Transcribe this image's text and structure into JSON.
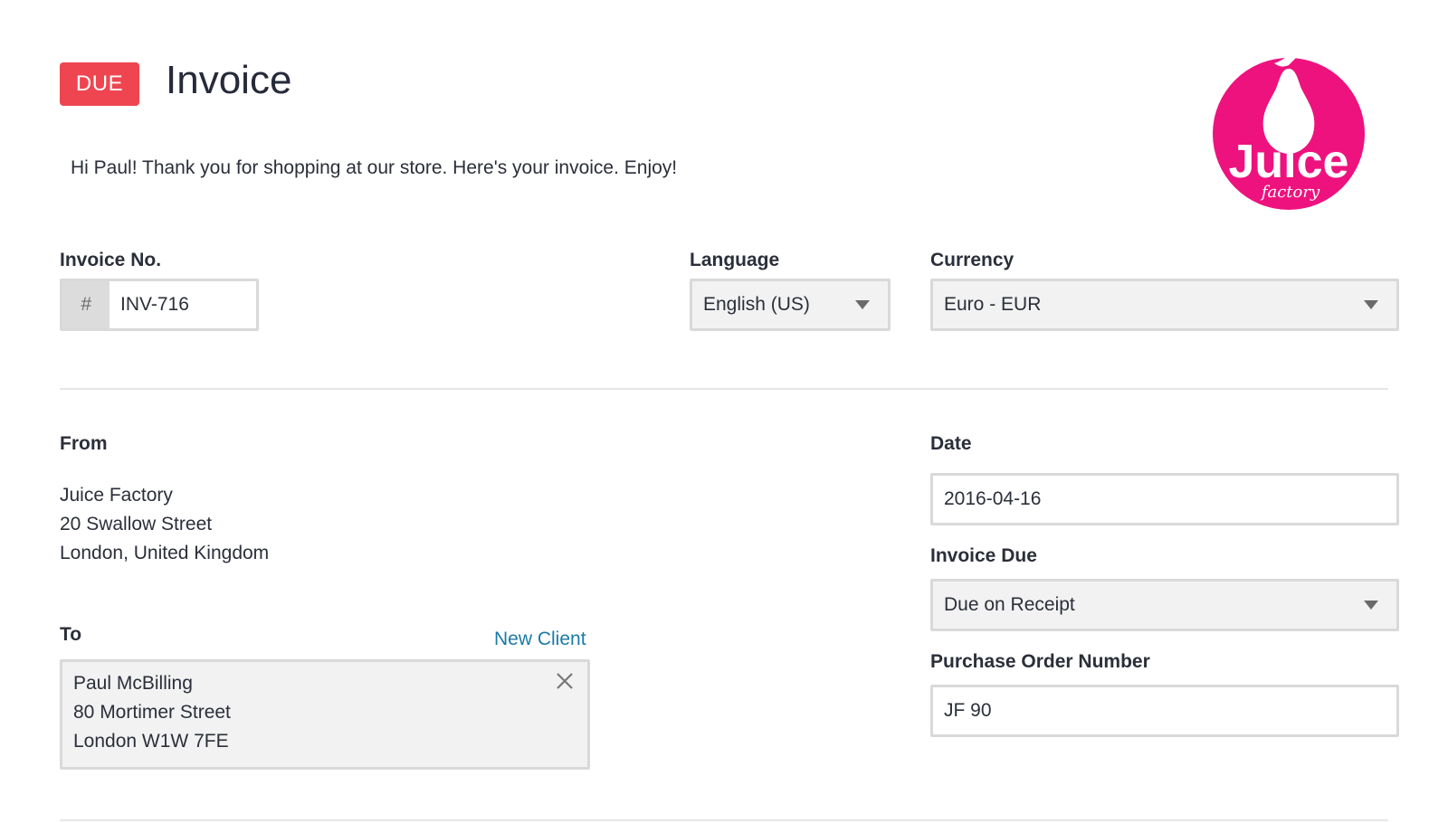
{
  "header": {
    "status_badge": "DUE",
    "title": "Invoice",
    "greeting": "Hi Paul! Thank you for shopping at our store. Here's your invoice. Enjoy!",
    "logo": {
      "brand": "Juice",
      "tagline": "factory",
      "color": "#ee127e",
      "icon": "pear-icon"
    }
  },
  "invoice_no": {
    "label": "Invoice No.",
    "prefix": "#",
    "value": "INV-716"
  },
  "language": {
    "label": "Language",
    "selected": "English (US)"
  },
  "currency": {
    "label": "Currency",
    "selected": "Euro - EUR"
  },
  "from": {
    "label": "From",
    "lines": [
      "Juice Factory",
      "20 Swallow Street",
      "London, United Kingdom"
    ]
  },
  "to": {
    "label": "To",
    "new_client_link": "New Client",
    "lines": [
      "Paul McBilling",
      "80 Mortimer Street",
      "London W1W 7FE"
    ]
  },
  "date": {
    "label": "Date",
    "value": "2016-04-16"
  },
  "invoice_due": {
    "label": "Invoice Due",
    "selected": "Due on Receipt"
  },
  "purchase_order": {
    "label": "Purchase Order Number",
    "value": "JF 90"
  },
  "colors": {
    "due_badge": "#ef4550",
    "link": "#1a7aa8",
    "brand": "#ee127e"
  }
}
